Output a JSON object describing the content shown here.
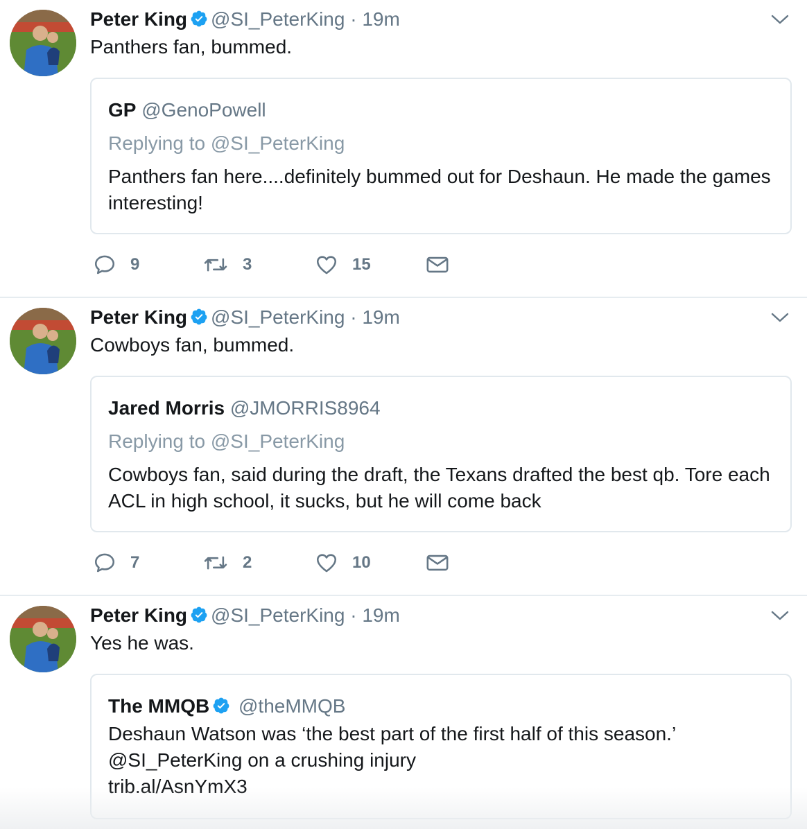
{
  "tweets": [
    {
      "name": "Peter King",
      "handle": "@SI_PeterKing",
      "dot": "·",
      "time": "19m",
      "text": "Panthers fan, bummed.",
      "quote": {
        "name": "GP",
        "handle": "@GenoPowell",
        "replying": "Replying to @SI_PeterKing",
        "text": "Panthers fan here....definitely bummed out for Deshaun. He made the games interesting!"
      },
      "replies": "9",
      "retweets": "3",
      "likes": "15"
    },
    {
      "name": "Peter King",
      "handle": "@SI_PeterKing",
      "dot": "·",
      "time": "19m",
      "text": "Cowboys fan, bummed.",
      "quote": {
        "name": "Jared Morris",
        "handle": "@JMORRIS8964",
        "replying": "Replying to @SI_PeterKing",
        "text": "Cowboys fan, said during the draft, the Texans drafted the best qb. Tore each ACL in high school, it sucks, but he will come back"
      },
      "replies": "7",
      "retweets": "2",
      "likes": "10"
    },
    {
      "name": "Peter King",
      "handle": "@SI_PeterKing",
      "dot": "·",
      "time": "19m",
      "text": "Yes he was.",
      "quote": {
        "name": "The MMQB",
        "handle": "@theMMQB",
        "text_line1": "Deshaun Watson was ‘the best part of the first half of this season.’",
        "text_line2": "@SI_PeterKing on a crushing injury",
        "text_line3": "trib.al/AsnYmX3"
      }
    }
  ],
  "colors": {
    "verified": "#1da1f2",
    "secondary_text": "#657786",
    "reply_context": "#8899a6",
    "border": "#e1e8ed"
  },
  "icons": [
    "verified-badge-icon",
    "caret-down-icon",
    "reply-icon",
    "retweet-icon",
    "heart-icon",
    "envelope-icon"
  ]
}
